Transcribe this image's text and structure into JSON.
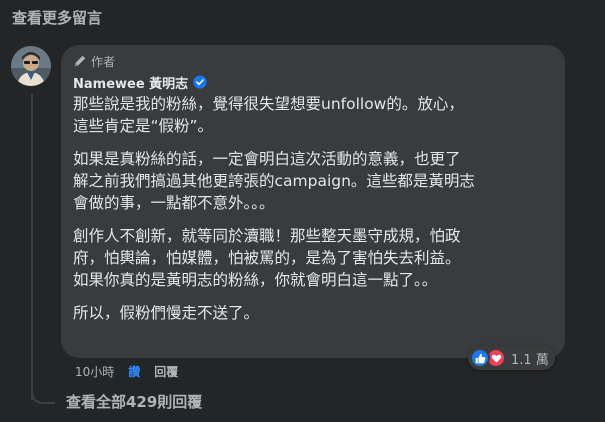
{
  "header": {
    "more_comments_label": "查看更多留言"
  },
  "comment": {
    "avatar_icon": "user-avatar-photo",
    "author_badge": "作者",
    "author_badge_icon": "pen-icon",
    "name": "Namewee 黃明志",
    "verified_icon": "verified-badge-icon",
    "paragraphs": [
      "那些說是我的粉絲，覺得很失望想要unfollow的。放心，\n這些肯定是“假粉”。",
      "如果是真粉絲的話，一定會明白這次活動的意義，也更了\n解之前我們搞過其他更誇張的campaign。這些都是黃明志\n會做的事，一點都不意外。。。",
      "創作人不創新，就等同於瀆職！那些整天墨守成規，怕政\n府，怕輿論，怕媒體，怕被罵的，是為了害怕失去利益。\n如果你真的是黃明志的粉絲，你就會明白這一點了。。",
      "所以，假粉們慢走不送了。"
    ],
    "time": "10小時",
    "like_label": "讚",
    "reply_label": "回覆",
    "reactions": {
      "icons": [
        "like-reaction-icon",
        "love-reaction-icon"
      ],
      "count": "1.1 萬"
    }
  },
  "footer": {
    "view_replies_label": "查看全部429則回覆"
  },
  "colors": {
    "background": "#242526",
    "bubble": "#3a3b3c",
    "text": "#e4e6eb",
    "secondary_text": "#b0b3b8",
    "link_blue": "#2d88ff",
    "like_blue": "#1877f2",
    "love_red": "#f33e58"
  }
}
